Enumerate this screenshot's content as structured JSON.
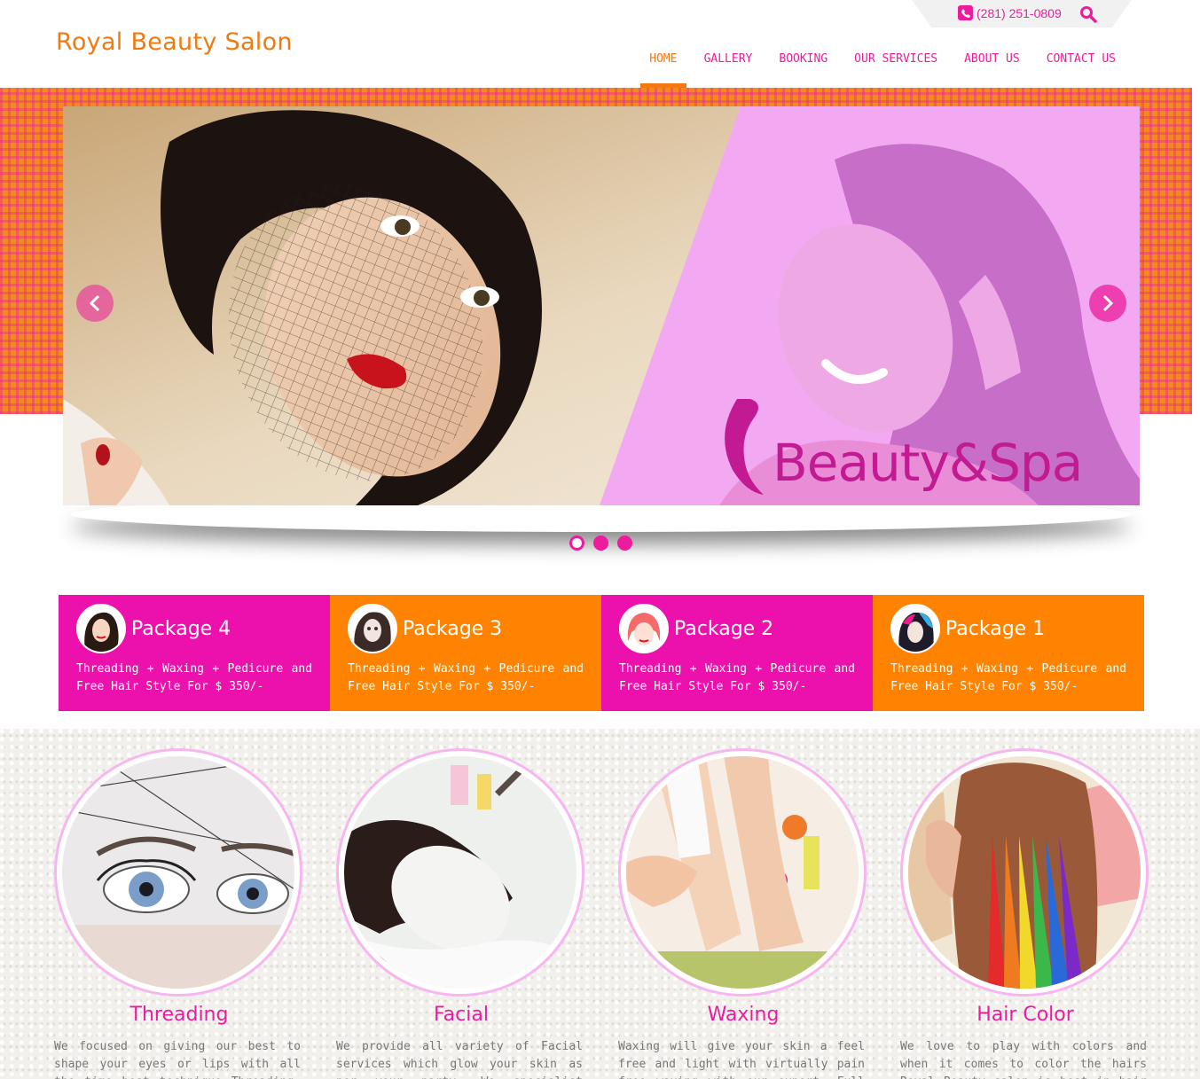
{
  "header": {
    "logo": "Royal Beauty Salon",
    "phone": "(281) 251-0809",
    "nav": [
      "HOME",
      "GALLERY",
      "BOOKING",
      "OUR SERVICES",
      "ABOUT US",
      "CONTACT US"
    ],
    "active_nav": "HOME"
  },
  "slider": {
    "caption": "Beauty&Spa",
    "dots": 3,
    "active_dot": 1
  },
  "packages": [
    {
      "title": "Package 4",
      "text": "Threading + Waxing + Pedicure and Free Hair Style For $ 350/-",
      "color": "#ec10ac"
    },
    {
      "title": "Package 3",
      "text": "Threading + Waxing + Pedicure and Free Hair Style For $ 350/-",
      "color": "#ff8300"
    },
    {
      "title": "Package 2",
      "text": "Threading + Waxing + Pedicure and Free Hair Style For $ 350/-",
      "color": "#ec10ac"
    },
    {
      "title": "Package 1",
      "text": "Threading + Waxing + Pedicure and Free Hair Style For $ 350/-",
      "color": "#ff8300"
    }
  ],
  "services": [
    {
      "title": "Threading",
      "text": "We focused on giving our best to shape your eyes or lips with all the time best technique Threading. Book your appointment"
    },
    {
      "title": "Facial",
      "text": "We provide all variety of Facial services which glow your skin as per your party. We specialist provides a fresh look to your face"
    },
    {
      "title": "Waxing",
      "text": "Waxing will give your skin a feel free and light with virtually pain free waxing with our expert. Full Arm Wax, Half Arm Wax and"
    },
    {
      "title": "Hair Color",
      "text": "We love to play with colors and when it comes to color the hairs Royal Beauty salon is best in hair treatment and hair dye"
    }
  ],
  "colors": {
    "pink": "#ec1c9c",
    "orange": "#f07a12"
  }
}
